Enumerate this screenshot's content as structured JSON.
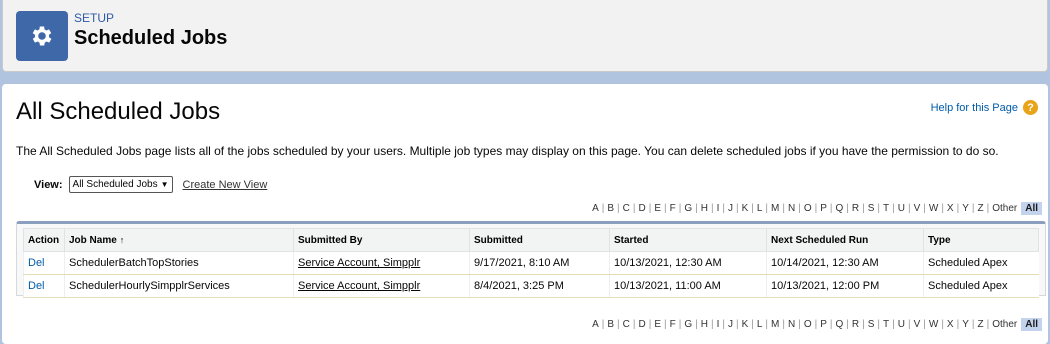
{
  "header": {
    "section": "SETUP",
    "title": "Scheduled Jobs",
    "icon": "gear-icon"
  },
  "page": {
    "title": "All Scheduled Jobs",
    "help_link": "Help for this Page",
    "description": "The All Scheduled Jobs page lists all of the jobs scheduled by your users. Multiple job types may display on this page. You can delete scheduled jobs if you have the permission to do so."
  },
  "view": {
    "label": "View:",
    "selected": "All Scheduled Jobs",
    "create_link": "Create New View"
  },
  "alpha": {
    "letters": [
      "A",
      "B",
      "C",
      "D",
      "E",
      "F",
      "G",
      "H",
      "I",
      "J",
      "K",
      "L",
      "M",
      "N",
      "O",
      "P",
      "Q",
      "R",
      "S",
      "T",
      "U",
      "V",
      "W",
      "X",
      "Y",
      "Z"
    ],
    "other": "Other",
    "all": "All"
  },
  "table": {
    "columns": [
      "Action",
      "Job Name",
      "Submitted By",
      "Submitted",
      "Started",
      "Next Scheduled Run",
      "Type"
    ],
    "sort_indicator": "↑",
    "rows": [
      {
        "action": "Del",
        "job_name": "SchedulerBatchTopStories",
        "submitted_by": "Service Account, Simpplr",
        "submitted": "9/17/2021, 8:10 AM",
        "started": "10/13/2021, 12:30 AM",
        "next_run": "10/14/2021, 12:30 AM",
        "type": "Scheduled Apex"
      },
      {
        "action": "Del",
        "job_name": "SchedulerHourlySimpplrServices",
        "submitted_by": "Service Account, Simpplr",
        "submitted": "8/4/2021, 3:25 PM",
        "started": "10/13/2021, 11:00 AM",
        "next_run": "10/13/2021, 12:00 PM",
        "type": "Scheduled Apex"
      }
    ]
  },
  "colors": {
    "accent": "#3e68a8",
    "link": "#015ba7",
    "help_icon": "#e8a317"
  }
}
